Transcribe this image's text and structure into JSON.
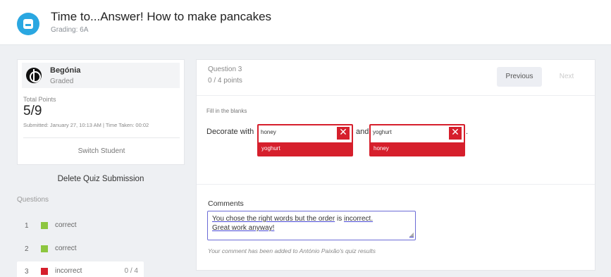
{
  "header": {
    "title": "Time to...Answer! How to make pancakes",
    "subtitle": "Grading: 6A"
  },
  "student": {
    "name": "Begónia",
    "status": "Graded",
    "total_points_label": "Total Points",
    "total_points_value": "5/9",
    "submitted_text": "Submitted: January 27, 10:13 AM | Time Taken: 00:02",
    "switch_label": "Switch Student"
  },
  "sidebar": {
    "delete_label": "Delete Quiz Submission",
    "questions_label": "Questions",
    "questions": [
      {
        "num": "1",
        "status": "correct",
        "color": "#8dc63f",
        "points": ""
      },
      {
        "num": "2",
        "status": "correct",
        "color": "#8dc63f",
        "points": ""
      },
      {
        "num": "3",
        "status": "incorrect",
        "color": "#d61f2c",
        "points": "0 / 4"
      }
    ]
  },
  "question": {
    "title": "Question 3",
    "points": "0 / 4 points",
    "prev_label": "Previous",
    "next_label": "Next",
    "instruction": "Fill in the blanks",
    "text_before": "Decorate with",
    "text_between": "and",
    "text_after": ".",
    "blanks": [
      {
        "answer": "honey",
        "correct": "yoghurt"
      },
      {
        "answer": "yoghurt",
        "correct": "honey"
      }
    ],
    "close_glyph": "✕"
  },
  "comments": {
    "label": "Comments",
    "line1_part1": "You chose the right words but the order",
    "line1_mid": " is ",
    "line1_part2": "incorrect.",
    "line2": "Great work anyway!",
    "note": "Your comment has been added to António Paixão's quiz results"
  },
  "colors": {
    "accent": "#2aa7e1",
    "incorrect": "#d61f2c",
    "correct": "#8dc63f"
  }
}
